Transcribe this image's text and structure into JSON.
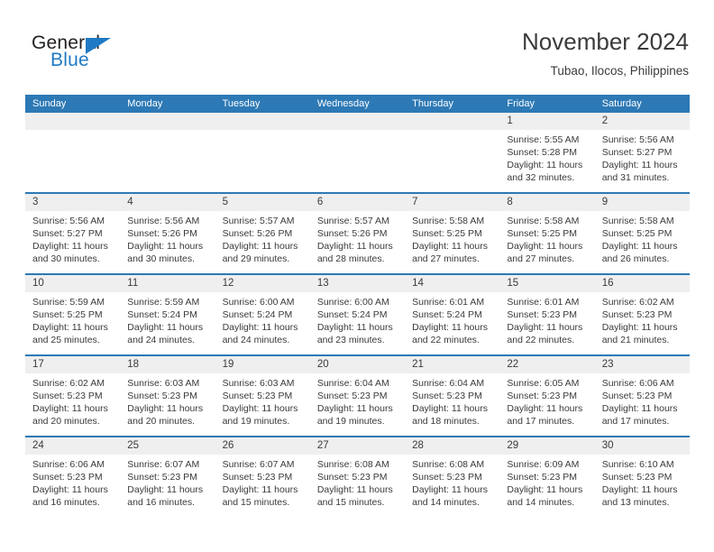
{
  "brand": {
    "name_top": "General",
    "name_bottom": "Blue",
    "accent_color": "#1f7ac4"
  },
  "header": {
    "title": "November 2024",
    "subtitle": "Tubao, Ilocos, Philippines"
  },
  "colors": {
    "header_row_bg": "#2d79b5",
    "date_band_bg": "#efefef",
    "text": "#3a3a3a"
  },
  "calendar": {
    "weekday_headers": [
      "Sunday",
      "Monday",
      "Tuesday",
      "Wednesday",
      "Thursday",
      "Friday",
      "Saturday"
    ],
    "weeks": [
      [
        {
          "day": "",
          "lines": []
        },
        {
          "day": "",
          "lines": []
        },
        {
          "day": "",
          "lines": []
        },
        {
          "day": "",
          "lines": []
        },
        {
          "day": "",
          "lines": []
        },
        {
          "day": "1",
          "lines": [
            "Sunrise: 5:55 AM",
            "Sunset: 5:28 PM",
            "Daylight: 11 hours",
            "and 32 minutes."
          ]
        },
        {
          "day": "2",
          "lines": [
            "Sunrise: 5:56 AM",
            "Sunset: 5:27 PM",
            "Daylight: 11 hours",
            "and 31 minutes."
          ]
        }
      ],
      [
        {
          "day": "3",
          "lines": [
            "Sunrise: 5:56 AM",
            "Sunset: 5:27 PM",
            "Daylight: 11 hours",
            "and 30 minutes."
          ]
        },
        {
          "day": "4",
          "lines": [
            "Sunrise: 5:56 AM",
            "Sunset: 5:26 PM",
            "Daylight: 11 hours",
            "and 30 minutes."
          ]
        },
        {
          "day": "5",
          "lines": [
            "Sunrise: 5:57 AM",
            "Sunset: 5:26 PM",
            "Daylight: 11 hours",
            "and 29 minutes."
          ]
        },
        {
          "day": "6",
          "lines": [
            "Sunrise: 5:57 AM",
            "Sunset: 5:26 PM",
            "Daylight: 11 hours",
            "and 28 minutes."
          ]
        },
        {
          "day": "7",
          "lines": [
            "Sunrise: 5:58 AM",
            "Sunset: 5:25 PM",
            "Daylight: 11 hours",
            "and 27 minutes."
          ]
        },
        {
          "day": "8",
          "lines": [
            "Sunrise: 5:58 AM",
            "Sunset: 5:25 PM",
            "Daylight: 11 hours",
            "and 27 minutes."
          ]
        },
        {
          "day": "9",
          "lines": [
            "Sunrise: 5:58 AM",
            "Sunset: 5:25 PM",
            "Daylight: 11 hours",
            "and 26 minutes."
          ]
        }
      ],
      [
        {
          "day": "10",
          "lines": [
            "Sunrise: 5:59 AM",
            "Sunset: 5:25 PM",
            "Daylight: 11 hours",
            "and 25 minutes."
          ]
        },
        {
          "day": "11",
          "lines": [
            "Sunrise: 5:59 AM",
            "Sunset: 5:24 PM",
            "Daylight: 11 hours",
            "and 24 minutes."
          ]
        },
        {
          "day": "12",
          "lines": [
            "Sunrise: 6:00 AM",
            "Sunset: 5:24 PM",
            "Daylight: 11 hours",
            "and 24 minutes."
          ]
        },
        {
          "day": "13",
          "lines": [
            "Sunrise: 6:00 AM",
            "Sunset: 5:24 PM",
            "Daylight: 11 hours",
            "and 23 minutes."
          ]
        },
        {
          "day": "14",
          "lines": [
            "Sunrise: 6:01 AM",
            "Sunset: 5:24 PM",
            "Daylight: 11 hours",
            "and 22 minutes."
          ]
        },
        {
          "day": "15",
          "lines": [
            "Sunrise: 6:01 AM",
            "Sunset: 5:23 PM",
            "Daylight: 11 hours",
            "and 22 minutes."
          ]
        },
        {
          "day": "16",
          "lines": [
            "Sunrise: 6:02 AM",
            "Sunset: 5:23 PM",
            "Daylight: 11 hours",
            "and 21 minutes."
          ]
        }
      ],
      [
        {
          "day": "17",
          "lines": [
            "Sunrise: 6:02 AM",
            "Sunset: 5:23 PM",
            "Daylight: 11 hours",
            "and 20 minutes."
          ]
        },
        {
          "day": "18",
          "lines": [
            "Sunrise: 6:03 AM",
            "Sunset: 5:23 PM",
            "Daylight: 11 hours",
            "and 20 minutes."
          ]
        },
        {
          "day": "19",
          "lines": [
            "Sunrise: 6:03 AM",
            "Sunset: 5:23 PM",
            "Daylight: 11 hours",
            "and 19 minutes."
          ]
        },
        {
          "day": "20",
          "lines": [
            "Sunrise: 6:04 AM",
            "Sunset: 5:23 PM",
            "Daylight: 11 hours",
            "and 19 minutes."
          ]
        },
        {
          "day": "21",
          "lines": [
            "Sunrise: 6:04 AM",
            "Sunset: 5:23 PM",
            "Daylight: 11 hours",
            "and 18 minutes."
          ]
        },
        {
          "day": "22",
          "lines": [
            "Sunrise: 6:05 AM",
            "Sunset: 5:23 PM",
            "Daylight: 11 hours",
            "and 17 minutes."
          ]
        },
        {
          "day": "23",
          "lines": [
            "Sunrise: 6:06 AM",
            "Sunset: 5:23 PM",
            "Daylight: 11 hours",
            "and 17 minutes."
          ]
        }
      ],
      [
        {
          "day": "24",
          "lines": [
            "Sunrise: 6:06 AM",
            "Sunset: 5:23 PM",
            "Daylight: 11 hours",
            "and 16 minutes."
          ]
        },
        {
          "day": "25",
          "lines": [
            "Sunrise: 6:07 AM",
            "Sunset: 5:23 PM",
            "Daylight: 11 hours",
            "and 16 minutes."
          ]
        },
        {
          "day": "26",
          "lines": [
            "Sunrise: 6:07 AM",
            "Sunset: 5:23 PM",
            "Daylight: 11 hours",
            "and 15 minutes."
          ]
        },
        {
          "day": "27",
          "lines": [
            "Sunrise: 6:08 AM",
            "Sunset: 5:23 PM",
            "Daylight: 11 hours",
            "and 15 minutes."
          ]
        },
        {
          "day": "28",
          "lines": [
            "Sunrise: 6:08 AM",
            "Sunset: 5:23 PM",
            "Daylight: 11 hours",
            "and 14 minutes."
          ]
        },
        {
          "day": "29",
          "lines": [
            "Sunrise: 6:09 AM",
            "Sunset: 5:23 PM",
            "Daylight: 11 hours",
            "and 14 minutes."
          ]
        },
        {
          "day": "30",
          "lines": [
            "Sunrise: 6:10 AM",
            "Sunset: 5:23 PM",
            "Daylight: 11 hours",
            "and 13 minutes."
          ]
        }
      ]
    ]
  }
}
